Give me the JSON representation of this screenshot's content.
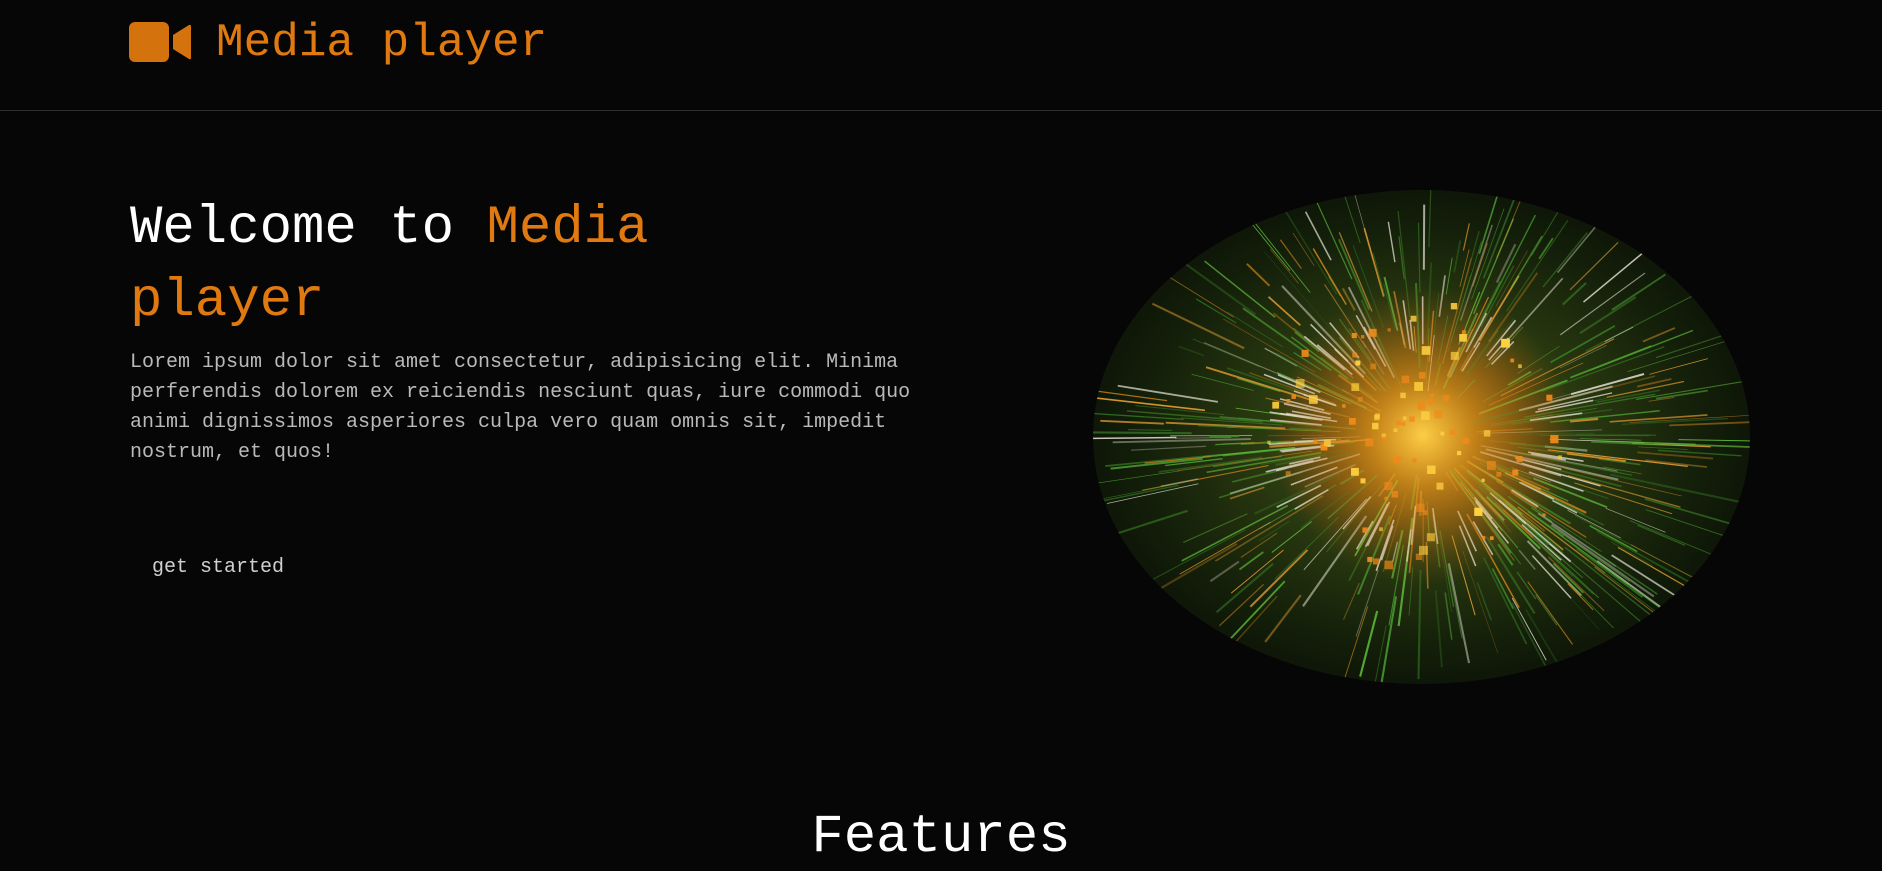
{
  "header": {
    "brand_name": "Media player",
    "brand_icon": "video-camera-icon"
  },
  "hero": {
    "title_prefix": "Welcome to ",
    "title_accent": "Media player",
    "description": "Lorem ipsum dolor sit amet consectetur, adipisicing elit. Minima perferendis dolorem ex reiciendis nesciunt quas, iure commodi quo animi dignissimos asperiores culpa vero quam omnis sit, impedit nostrum, et quos!",
    "cta_label": "get started",
    "image_subject": "abstract-light-tunnel-image"
  },
  "features": {
    "title": "Features"
  },
  "colors": {
    "background": "#060606",
    "accent": "#e07a10",
    "text_primary": "#ffffff",
    "text_secondary": "#b9b9b9",
    "divider": "#2e2e2e"
  }
}
